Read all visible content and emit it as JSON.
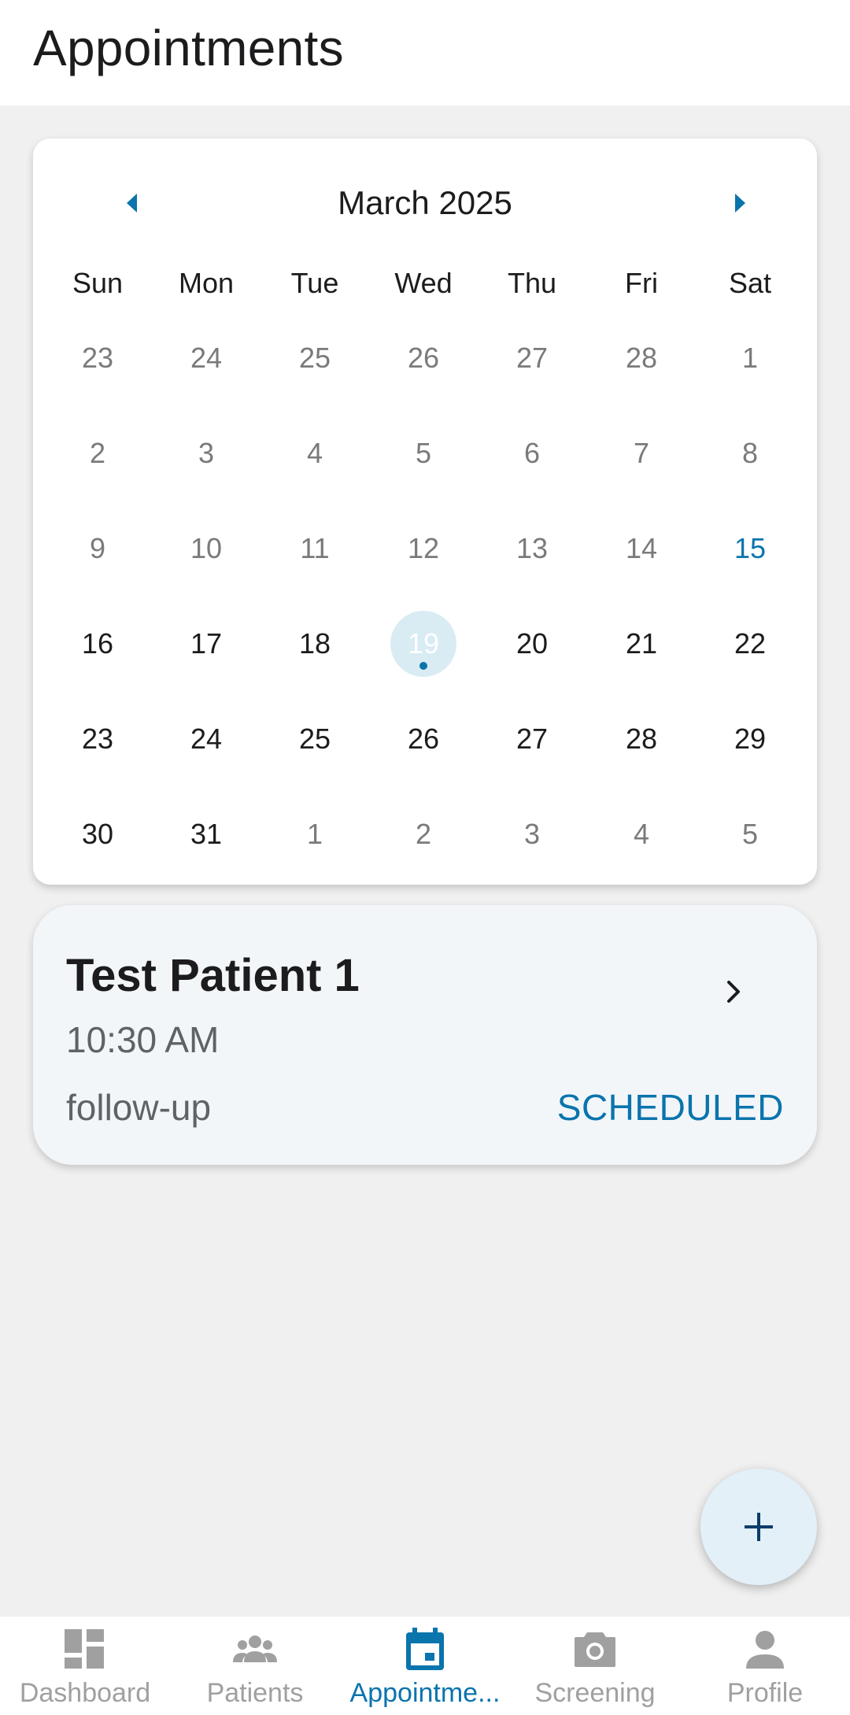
{
  "header": {
    "title": "Appointments"
  },
  "calendar": {
    "month_label": "March 2025",
    "weekdays": [
      "Sun",
      "Mon",
      "Tue",
      "Wed",
      "Thu",
      "Fri",
      "Sat"
    ],
    "weeks": [
      [
        "23",
        "24",
        "25",
        "26",
        "27",
        "28",
        "1"
      ],
      [
        "2",
        "3",
        "4",
        "5",
        "6",
        "7",
        "8"
      ],
      [
        "9",
        "10",
        "11",
        "12",
        "13",
        "14",
        "15"
      ],
      [
        "16",
        "17",
        "18",
        "19",
        "20",
        "21",
        "22"
      ],
      [
        "23",
        "24",
        "25",
        "26",
        "27",
        "28",
        "29"
      ],
      [
        "30",
        "31",
        "1",
        "2",
        "3",
        "4",
        "5"
      ]
    ],
    "today": "15",
    "selected": "19",
    "accent_color": "#0a74ad"
  },
  "appointment": {
    "patient_name": "Test Patient 1",
    "time": "10:30 AM",
    "type": "follow-up",
    "status": "SCHEDULED"
  },
  "fab": {
    "icon": "plus-icon"
  },
  "bottom_nav": {
    "items": [
      {
        "label": "Dashboard",
        "icon": "dashboard-icon",
        "active": false
      },
      {
        "label": "Patients",
        "icon": "patients-icon",
        "active": false
      },
      {
        "label": "Appointme...",
        "icon": "calendar-icon",
        "active": true
      },
      {
        "label": "Screening",
        "icon": "camera-icon",
        "active": false
      },
      {
        "label": "Profile",
        "icon": "person-icon",
        "active": false
      }
    ]
  }
}
